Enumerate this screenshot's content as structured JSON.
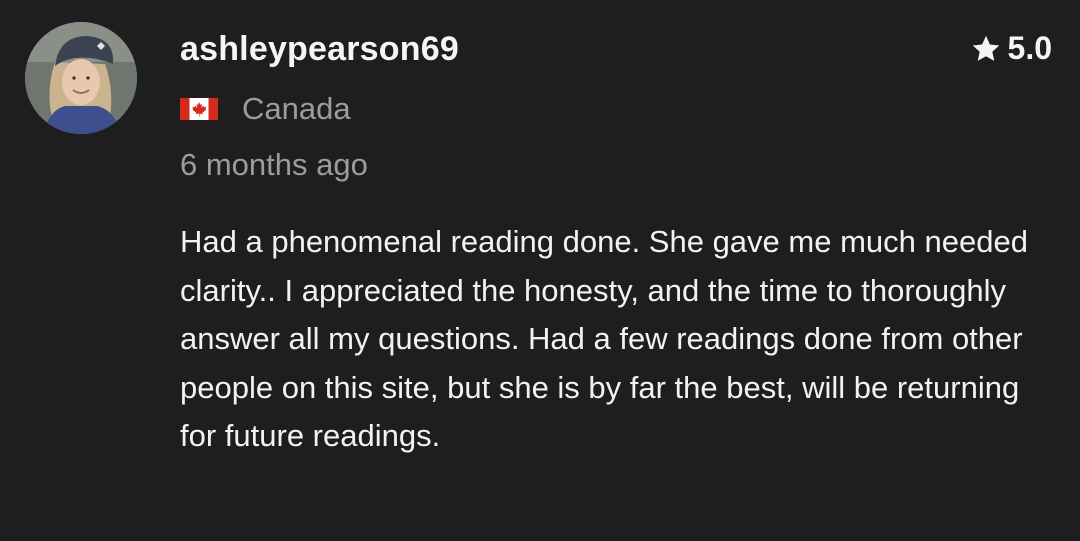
{
  "review": {
    "username": "ashleypearson69",
    "rating": "5.0",
    "country": "Canada",
    "country_flag_icon": "canada-flag-icon",
    "time_ago": "6 months ago",
    "text": "Had a phenomenal reading done. She gave me much needed clarity.. I appreciated the honesty, and the time to thoroughly answer all my questions. Had a few readings done from other people on this site, but she is by far the best, will be returning for future readings."
  },
  "colors": {
    "background": "#1e1e20",
    "primary_text": "#f2f2f2",
    "secondary_text": "#9c9c9c",
    "flag_red": "#d52b1e"
  }
}
